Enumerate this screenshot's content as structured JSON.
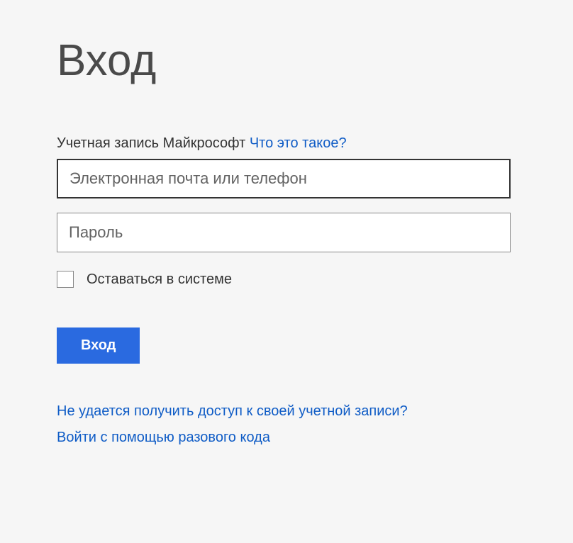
{
  "page": {
    "title": "Вход"
  },
  "account": {
    "label": "Учетная запись Майкрософт",
    "whatIsThis": "Что это такое?"
  },
  "fields": {
    "email_placeholder": "Электронная почта или телефон",
    "password_placeholder": "Пароль"
  },
  "checkbox": {
    "label": "Оставаться в системе"
  },
  "submit": {
    "label": "Вход"
  },
  "links": {
    "cantAccess": "Не удается получить доступ к своей учетной записи?",
    "oneTimeCode": "Войти с помощью разового кода"
  }
}
